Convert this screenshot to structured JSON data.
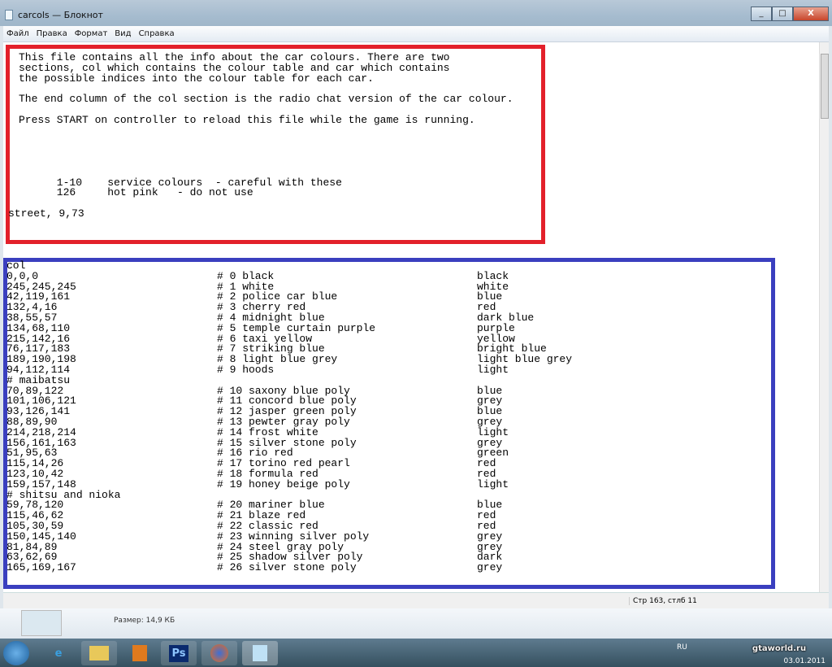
{
  "window": {
    "title": "carcols — Блокнот",
    "minimize": "_",
    "maximize": "□",
    "close": "X"
  },
  "menu": [
    "Файл",
    "Правка",
    "Формат",
    "Вид",
    "Справка"
  ],
  "header_lines": [
    "This file contains all the info about the car colours. There are two",
    "sections, col which contains the colour table and car which contains",
    "the possible indices into the colour table for each car.",
    "",
    "The end column of the col section is the radio chat version of the car colour.",
    "",
    "Press START on controller to reload this file while the game is running.",
    "",
    "",
    "",
    "",
    "",
    "      1-10    service colours  - careful with these",
    "      126     hot pink   - do not use",
    "",
    "street, 9,73"
  ],
  "col_rows": [
    [
      "col",
      "",
      ""
    ],
    [
      "0,0,0",
      "# 0 black",
      "black"
    ],
    [
      "245,245,245",
      "# 1 white",
      "white"
    ],
    [
      "42,119,161",
      "# 2 police car blue",
      "blue"
    ],
    [
      "132,4,16",
      "# 3 cherry red",
      "red"
    ],
    [
      "38,55,57",
      "# 4 midnight blue",
      "dark blue"
    ],
    [
      "134,68,110",
      "# 5 temple curtain purple",
      "purple"
    ],
    [
      "215,142,16",
      "# 6 taxi yellow",
      "yellow"
    ],
    [
      "76,117,183",
      "# 7 striking blue",
      "bright blue"
    ],
    [
      "189,190,198",
      "# 8 light blue grey",
      "light blue grey"
    ],
    [
      "94,112,114",
      "# 9 hoods",
      "light"
    ],
    [
      "# maibatsu",
      "",
      ""
    ],
    [
      "70,89,122",
      "# 10 saxony blue poly",
      "blue"
    ],
    [
      "101,106,121",
      "# 11 concord blue poly",
      "grey"
    ],
    [
      "93,126,141",
      "# 12 jasper green poly",
      "blue"
    ],
    [
      "88,89,90",
      "# 13 pewter gray poly",
      "grey"
    ],
    [
      "214,218,214",
      "# 14 frost white",
      "light"
    ],
    [
      "156,161,163",
      "# 15 silver stone poly",
      "grey"
    ],
    [
      "51,95,63",
      "# 16 rio red",
      "green"
    ],
    [
      "115,14,26",
      "# 17 torino red pearl",
      "red"
    ],
    [
      "123,10,42",
      "# 18 formula red",
      "red"
    ],
    [
      "159,157,148",
      "# 19 honey beige poly",
      "light"
    ],
    [
      "# shitsu and nioka",
      "",
      ""
    ],
    [
      "59,78,120",
      "# 20 mariner blue",
      "blue"
    ],
    [
      "115,46,62",
      "# 21 blaze red",
      "red"
    ],
    [
      "105,30,59",
      "# 22 classic red",
      "red"
    ],
    [
      "150,145,140",
      "# 23 winning silver poly",
      "grey"
    ],
    [
      "81,84,89",
      "# 24 steel gray poly",
      "grey"
    ],
    [
      "63,62,69",
      "# 25 shadow silver poly",
      "dark"
    ],
    [
      "165,169,167",
      "# 26 silver stone poly",
      "grey"
    ]
  ],
  "status": {
    "position": "Стр 163, стлб 11"
  },
  "details": {
    "size": "Размер: 14,9 КБ"
  },
  "taskbar": {
    "apps": [
      "start",
      "internet-explorer",
      "explorer",
      "media-player",
      "photoshop",
      "firefox",
      "notepad"
    ],
    "ps_label": "Ps",
    "lang": "RU",
    "date": "03.01.2011"
  },
  "watermark": "gtaworld.ru",
  "colors": {
    "red_box": "#e3202a",
    "blue_box": "#3a3fbf"
  }
}
